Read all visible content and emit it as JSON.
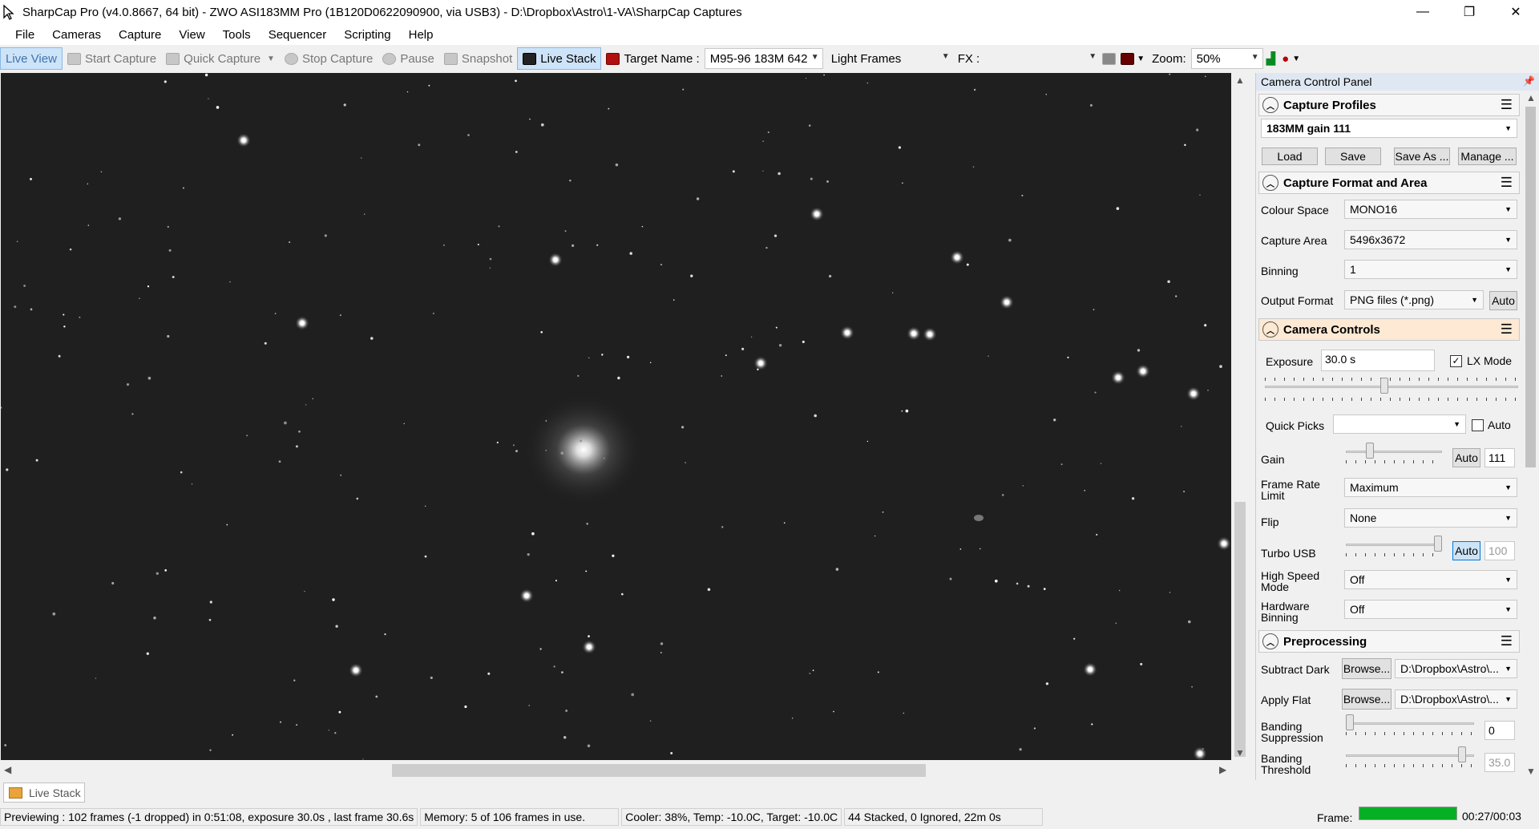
{
  "window": {
    "title": "SharpCap Pro (v4.0.8667, 64 bit) - ZWO ASI183MM Pro (1B120D0622090900, via USB3) - D:\\Dropbox\\Astro\\1-VA\\SharpCap Captures",
    "minimize": "—",
    "restore": "❐",
    "close": "✕"
  },
  "menu": [
    "File",
    "Cameras",
    "Capture",
    "View",
    "Tools",
    "Sequencer",
    "Scripting",
    "Help"
  ],
  "toolbar": {
    "live_view": "Live View",
    "start_capture": "Start Capture",
    "quick_capture": "Quick Capture",
    "stop_capture": "Stop Capture",
    "pause": "Pause",
    "snapshot": "Snapshot",
    "live_stack": "Live Stack",
    "target_name_label": "Target Name :",
    "target_name_value": "M95-96 183M 642",
    "frame_type": "Light Frames",
    "fx_label": "FX :",
    "zoom_label": "Zoom:",
    "zoom_value": "50%"
  },
  "panel": {
    "title": "Camera Control Panel",
    "capture_profiles": {
      "header": "Capture Profiles",
      "profile": "183MM gain 111",
      "load": "Load",
      "save": "Save",
      "save_as": "Save As ...",
      "manage": "Manage ..."
    },
    "format": {
      "header": "Capture Format and Area",
      "colour_space_label": "Colour Space",
      "colour_space": "MONO16",
      "capture_area_label": "Capture Area",
      "capture_area": "5496x3672",
      "binning_label": "Binning",
      "binning": "1",
      "output_format_label": "Output Format",
      "output_format": "PNG files (*.png)",
      "auto": "Auto"
    },
    "controls": {
      "header": "Camera Controls",
      "exposure_label": "Exposure",
      "exposure": "30.0 s",
      "lx_mode": "LX Mode",
      "quick_picks_label": "Quick Picks",
      "quick_picks_auto": "Auto",
      "gain_label": "Gain",
      "gain_auto": "Auto",
      "gain": "111",
      "frame_rate_label": "Frame Rate\nLimit",
      "frame_rate": "Maximum",
      "flip_label": "Flip",
      "flip": "None",
      "turbo_label": "Turbo USB",
      "turbo_auto": "Auto",
      "turbo": "100",
      "high_speed_label": "High Speed\nMode",
      "high_speed": "Off",
      "hw_binning_label": "Hardware\nBinning",
      "hw_binning": "Off"
    },
    "preprocessing": {
      "header": "Preprocessing",
      "subtract_dark_label": "Subtract Dark",
      "browse": "Browse...",
      "dark_path": "D:\\Dropbox\\Astro\\...",
      "apply_flat_label": "Apply Flat",
      "flat_path": "D:\\Dropbox\\Astro\\...",
      "banding_supp_label": "Banding\nSuppression",
      "banding_supp": "0",
      "banding_thresh_label": "Banding\nThreshold",
      "banding_thresh": "35.0"
    }
  },
  "bottom_tab": "Live Stack",
  "status": {
    "preview": "Previewing : 102 frames (-1 dropped) in 0:51:08, exposure 30.0s , last frame 30.6s",
    "memory": "Memory: 5 of 106 frames in use.",
    "cooler": "Cooler: 38%, Temp: -10.0C, Target: -10.0C",
    "stacked": "44 Stacked, 0 Ignored, 22m 0s",
    "frame_label": "Frame:",
    "frame_progress": 1.0,
    "frame_time": "00:27/00:03"
  },
  "colors": {
    "sky": "#1f1f1f",
    "progress": "#06b025",
    "highlight": "#cde3f7",
    "camera_controls_header": "#fde9d4"
  }
}
